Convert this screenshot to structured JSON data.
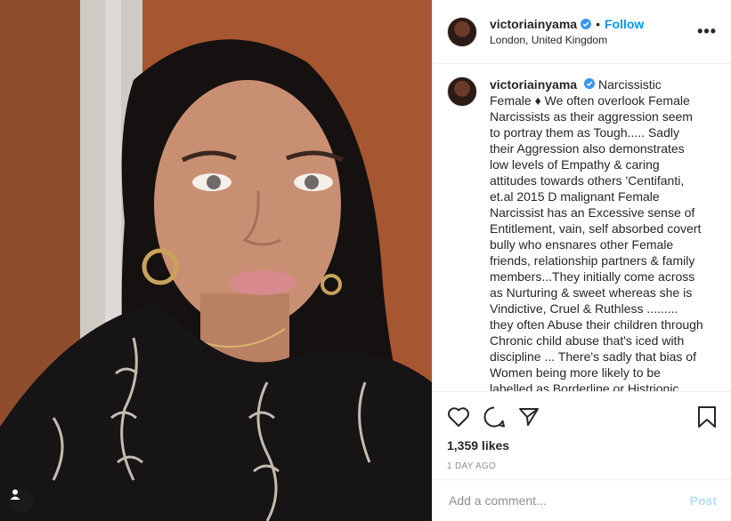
{
  "post": {
    "username": "victoriainyama",
    "separator": "•",
    "follow_label": "Follow",
    "location": "London, United Kingdom",
    "more_label": "•••",
    "caption": "Narcissistic Female ♦ We often overlook Female Narcissists as their aggression seem to portray them as Tough..... Sadly their Aggression also demonstrates low levels of Empathy & caring attitudes towards others 'Centifanti, et.al 2015 D malignant Female Narcissist has an Excessive sense of Entitlement, vain, self absorbed covert bully who ensnares other Female friends, relationship partners & family members...They initially come across as Nurturing & sweet whereas she is Vindictive, Cruel & Ruthless ......... they often Abuse their children through Chronic child abuse that's iced with discipline ... There's sadly that bias of Women being more likely to be labelled as Borderline or Histrionic",
    "likes": "1,359 likes",
    "timestamp": "1 DAY AGO",
    "comment_placeholder": "Add a comment...",
    "post_label": "Post"
  },
  "icons": {
    "verified": "verified-badge-icon",
    "like": "heart-icon",
    "comment": "comment-icon",
    "share": "share-icon",
    "save": "bookmark-icon",
    "user_tag": "user-tag-icon"
  },
  "colors": {
    "accent": "#0095f6",
    "post_disabled": "#b2dffc",
    "text": "#262626",
    "muted": "#8e8e8e"
  }
}
